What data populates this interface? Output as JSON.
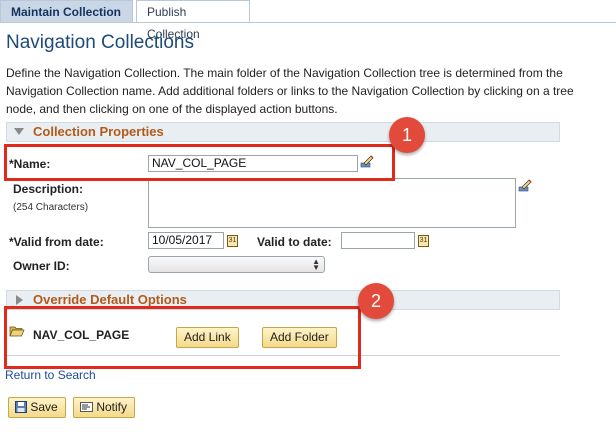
{
  "tabs": [
    {
      "label": "Maintain Collection",
      "active": true
    },
    {
      "label": "Publish Collection",
      "active": false
    }
  ],
  "page": {
    "title": "Navigation Collections",
    "description": "Define the Navigation Collection. The main folder of the Navigation Collection tree is determined from the Navigation Collection name. Add additional folders or links to the Navigation Collection by clicking on a tree node, and then clicking on one of the displayed action buttons."
  },
  "collection_properties": {
    "header": "Collection Properties",
    "name_label": "*Name:",
    "name_value": "NAV_COL_PAGE",
    "description_label": "Description:",
    "description_hint": "(254 Characters)",
    "description_value": "",
    "valid_from_label": "*Valid from date:",
    "valid_from_value": "10/05/2017",
    "valid_to_label": "Valid to date:",
    "valid_to_value": "",
    "owner_label": "Owner ID:",
    "owner_value": ""
  },
  "override": {
    "header": "Override Default Options"
  },
  "tree": {
    "root_label": "NAV_COL_PAGE",
    "add_link_label": "Add Link",
    "add_folder_label": "Add Folder"
  },
  "footer": {
    "return_link": "Return to Search",
    "save_label": "Save",
    "notify_label": "Notify"
  },
  "annotations": {
    "badge_1": "1",
    "badge_2": "2"
  },
  "icons": [
    "pencil-icon",
    "calendar-icon",
    "folder-open-icon",
    "save-icon",
    "notify-icon",
    "chevron-down-icon",
    "chevron-right-icon"
  ],
  "colors": {
    "accent_title": "#1e4a7a",
    "section_header_text": "#b35a1a",
    "highlight": "#e02b1c",
    "badge": "#e24a3b",
    "button_bg": "#f3d98a"
  }
}
